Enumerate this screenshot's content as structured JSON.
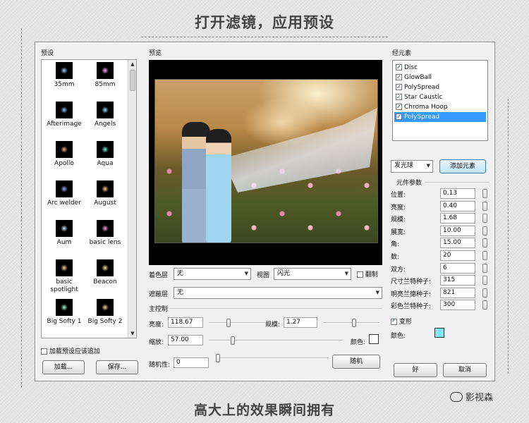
{
  "captions": {
    "top": "打开滤镜，应用预设",
    "bottom": "高大上的效果瞬间拥有"
  },
  "watermark": {
    "icon": "wechat-icon",
    "text": "影视森"
  },
  "presets": {
    "label": "预设",
    "items": [
      {
        "name": "35mm",
        "glow": "#9fd0ff"
      },
      {
        "name": "85mm",
        "glow": "#ffb0ff"
      },
      {
        "name": "Afterimage",
        "glow": "#7fc8ff"
      },
      {
        "name": "Angels",
        "glow": "#9fe0ff"
      },
      {
        "name": "Apollo",
        "glow": "#ffb08a"
      },
      {
        "name": "Aqua",
        "glow": "#7ff0e0"
      },
      {
        "name": "Arc welder",
        "glow": "#8fb0ff"
      },
      {
        "name": "August",
        "glow": "#ffcf8f"
      },
      {
        "name": "Aum",
        "glow": "#d0e8ff"
      },
      {
        "name": "basic lens",
        "glow": "#ff9fe0"
      },
      {
        "name": "basic spotlight",
        "glow": "#ffd08a"
      },
      {
        "name": "Beacon",
        "glow": "#ffe0a0"
      },
      {
        "name": "Big Softy 1",
        "glow": "#a0ffd0"
      },
      {
        "name": "Big Softy 2",
        "glow": "#ffd09f"
      }
    ],
    "append_label": "加载预设应该追加",
    "load_button": "加载...",
    "save_button": "保存..."
  },
  "preview": {
    "label": "预览",
    "tint_layer_label": "着色层",
    "tint_layer_value": "无",
    "view_label": "视图",
    "view_value": "闪光",
    "copy_label": "翻制",
    "mask_layer_label": "遮蔽层",
    "mask_layer_value": "无",
    "main_control_label": "主控制",
    "brightness_label": "亮度:",
    "brightness_value": "118.67",
    "brightness_level": 0.35,
    "scale_label": "规模:",
    "scale_value": "1.27",
    "scale_level": 0.55,
    "zoom_label": "缩放:",
    "zoom_value": "57.00",
    "zoom_level": 0.18,
    "color_label": "颜色:",
    "color_value": "#ffffff",
    "random_label": "随机性:",
    "random_value": "0",
    "random_level": 0.02,
    "random_button": "随机"
  },
  "elements": {
    "label": "经元素",
    "items": [
      {
        "name": "Disc",
        "checked": true,
        "selected": false
      },
      {
        "name": "GlowBall",
        "checked": true,
        "selected": false
      },
      {
        "name": "PolySpread",
        "checked": true,
        "selected": false
      },
      {
        "name": "Star Caustic",
        "checked": true,
        "selected": false
      },
      {
        "name": "Chroma Hoop",
        "checked": true,
        "selected": false
      },
      {
        "name": "PolySpread",
        "checked": true,
        "selected": true
      }
    ],
    "type_value": "发光球",
    "add_button": "添加元素",
    "params_label": "元件参数",
    "params": [
      {
        "label": "位置:",
        "value": "0.13"
      },
      {
        "label": "亮度:",
        "value": "0.40"
      },
      {
        "label": "规模:",
        "value": "1.68"
      },
      {
        "label": "展宽:",
        "value": "10.00"
      },
      {
        "label": "角:",
        "value": "15.00"
      },
      {
        "label": "数:",
        "value": "20"
      },
      {
        "label": "双方:",
        "value": "6"
      },
      {
        "label": "尺寸兰特种子:",
        "value": "315"
      },
      {
        "label": "明亮兰德种子:",
        "value": "821"
      },
      {
        "label": "彩色兰特种子:",
        "value": "300"
      }
    ],
    "deform_label": "变形",
    "color_label": "颜色:",
    "color_value": "#7fe8f6"
  },
  "buttons": {
    "ok": "好",
    "cancel": "取消"
  }
}
